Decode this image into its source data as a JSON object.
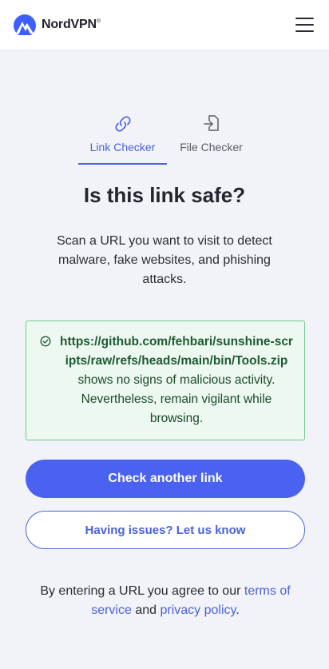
{
  "header": {
    "brand": "NordVPN",
    "brand_mark": "®",
    "logo_icon": "nordvpn-mountain-logo",
    "menu_icon": "hamburger-icon"
  },
  "tabs": [
    {
      "label": "Link Checker",
      "icon": "link-icon",
      "active": true
    },
    {
      "label": "File Checker",
      "icon": "file-import-icon",
      "active": false
    }
  ],
  "main": {
    "title": "Is this link safe?",
    "subtitle": "Scan a URL you want to visit to detect malware, fake websites, and phishing attacks."
  },
  "result": {
    "icon": "check-circle-icon",
    "url": "https://github.com/fehbari/sunshine-scripts/raw/refs/heads/main/bin/Tools.zip",
    "message": "shows no signs of malicious activity. Nevertheless, remain vigilant while browsing.",
    "status_color": "#6fca8f"
  },
  "actions": {
    "primary_label": "Check another link",
    "secondary_label": "Having issues? Let us know"
  },
  "footer": {
    "prefix": "By entering a URL you agree to our ",
    "terms_link": "terms of service",
    "and": " and ",
    "privacy_link": "privacy policy",
    "suffix": "."
  },
  "colors": {
    "accent": "#4a62f0",
    "link": "#4a62d8",
    "background": "#f2f3f8"
  }
}
